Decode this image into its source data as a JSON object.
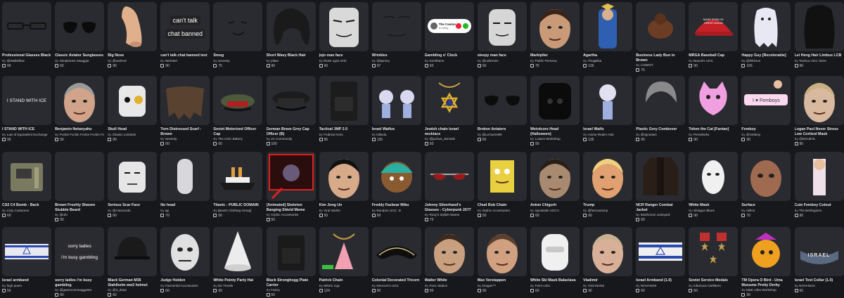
{
  "items": [
    {
      "name": "Professional Glasses Black",
      "creator": "@Wallstflow",
      "price": "90",
      "art": "glasses"
    },
    {
      "name": "Classic Aviator Sunglasses",
      "creator": "Simpletons Swagger",
      "price": "60",
      "art": "aviators"
    },
    {
      "name": "Big Nose",
      "creator": "@unDroX",
      "price": "90",
      "art": "nose"
    },
    {
      "name": "can't talk chat banned text",
      "creator": "Wembel",
      "price": "90",
      "art": "text",
      "text1": "can't talk",
      "text2": "chat banned"
    },
    {
      "name": "Smug",
      "creator": "Seventy",
      "price": "75",
      "art": "smug"
    },
    {
      "name": "Short Wavy Black Hair",
      "creator": "plitan",
      "price": "90",
      "art": "hair"
    },
    {
      "name": "jojo man face",
      "creator": "those ugcs smh",
      "price": "90",
      "art": "jojo"
    },
    {
      "name": "Wrinkles",
      "creator": "@5priory",
      "price": "97",
      "art": "wrinkles"
    },
    {
      "name": "Gambling o' Clock",
      "creator": "Kornflame",
      "price": "60",
      "art": "call",
      "text1": "The Casino",
      "text2": "is calling..."
    },
    {
      "name": "sleepy man face",
      "creator": "@uulkronin",
      "price": "50",
      "art": "sleepy"
    },
    {
      "name": "Markiplier",
      "creator": "Public Persona",
      "price": "75",
      "art": "face1"
    },
    {
      "name": "Agartha",
      "creator": "ThugBiba",
      "price": "135",
      "art": "agartha"
    },
    {
      "name": "Business Lady Bun in Brown",
      "creator": "LOWNIT",
      "price": "75",
      "art": "bun"
    },
    {
      "name": "MRGA Baseball Cap",
      "creator": "Bound's UGC",
      "price": "90",
      "art": "cap",
      "text1": "MAKE ROBLOX",
      "text2": "GREAT AGAIN"
    },
    {
      "name": "Happy Guy [Recolorable]",
      "creator": "@RKbrus",
      "price": "165",
      "art": "ghost"
    },
    {
      "name": "Lei Heng Hair Limbus LCB",
      "creator": "Touhou UGC Store",
      "price": "90",
      "art": "longhair"
    },
    {
      "name": "I STAND WITH ICE",
      "creator": "Law of Equivalent Exchange",
      "price": "90",
      "art": "text",
      "text1": "I STAND WITH ICE",
      "text2": ""
    },
    {
      "name": "Benjamin Netanyahu",
      "creator": "Fvckin Fvckin Fvckin Fvckin Fvckin",
      "price": "90",
      "art": "face2"
    },
    {
      "name": "Skull Head",
      "creator": "Classic Limiteds",
      "price": "90",
      "art": "skull"
    },
    {
      "name": "Torn Distressed Scarf - Brown",
      "creator": "Seventy",
      "price": "60",
      "art": "scarf"
    },
    {
      "name": "Soviet Motorized Officer Cap",
      "creator": "The UGC Bakery",
      "price": "60",
      "art": "officercap"
    },
    {
      "name": "German Brave Grey Cap Officer (B)",
      "creator": "JC Community",
      "price": "100",
      "art": "greycap"
    },
    {
      "name": "Tactical JMP 2.0",
      "creator": "Federal Arms",
      "price": "85",
      "art": "vest"
    },
    {
      "name": "Israel Waifus",
      "creator": "lollacla",
      "price": "135",
      "art": "waifus"
    },
    {
      "name": "Jewish chain Israel necklace",
      "creator": "@jachus_dominik",
      "price": "50",
      "art": "star"
    },
    {
      "name": "Broken Aviators",
      "creator": "@LeGame6R",
      "price": "60",
      "art": "brokenav"
    },
    {
      "name": "Weirdcore Head (Halloween)",
      "creator": "Luisa's Workshop",
      "price": "90",
      "art": "weird"
    },
    {
      "name": "Israel Waifu",
      "creator": "Anime Realm Hub",
      "price": "135",
      "art": "waifu"
    },
    {
      "name": "Plastic Grey Combover",
      "creator": "@vgcetass",
      "price": "90",
      "art": "combover"
    },
    {
      "name": "Token the Cat [Fantan]",
      "creator": "PeroWorks",
      "price": "90",
      "art": "cat"
    },
    {
      "name": "Femboy",
      "creator": "@rarfamy",
      "price": "90",
      "art": "femboy",
      "text1": "I ♥ Femboys",
      "text2": ""
    },
    {
      "name": "Logan Paul Never Stress Low Cortisol Mask",
      "creator": "@EGU87IL",
      "price": "90",
      "art": "face3"
    },
    {
      "name": "CS2 C4 Bomb - Back",
      "creator": "Coty Costumes",
      "price": "60",
      "art": "bomb"
    },
    {
      "name": "Brown Freshly Shaven Stubble Beard",
      "creator": "@ufo",
      "price": "90",
      "art": "stubble"
    },
    {
      "name": "Serious Scar Face",
      "creator": "@Antonrode",
      "price": "60",
      "art": "serious"
    },
    {
      "name": "No head",
      "creator": "ap",
      "price": "70",
      "art": "nohead"
    },
    {
      "name": "Titanic - PUBLIC DOMAIN",
      "creator": "[Boat's Clothing Group]",
      "price": "50",
      "art": "titanic"
    },
    {
      "name": "[Animated] Skeleton Banging Shield Meme",
      "creator": "Orphic Accessories",
      "price": "50",
      "art": "skeleton"
    },
    {
      "name": "Kim Jong Un",
      "creator": "Viral Works",
      "price": "50",
      "art": "face4"
    },
    {
      "name": "Freddy Fazbear Miku",
      "creator": "Random UGC :D",
      "price": "50",
      "art": "miku"
    },
    {
      "name": "Johnny Silverhand's Glasses - Cyberpunk 2077",
      "creator": "Roxy's Stylish Wares",
      "price": "70",
      "art": "johnny"
    },
    {
      "name": "Chud Bob Chain",
      "creator": "Orphic Accessories",
      "price": "50",
      "art": "chudbob"
    },
    {
      "name": "Anton Chigurh",
      "creator": "SpookIde UGC's",
      "price": "60",
      "art": "face5"
    },
    {
      "name": "Trump",
      "creator": "@famoussmp",
      "price": "90",
      "art": "face6"
    },
    {
      "name": "NCR Ranger Combat Jacket",
      "creator": "Mushroom Junkyard",
      "price": "60",
      "art": "jacket"
    },
    {
      "name": "White Mask",
      "creator": "Shotgun Blues",
      "price": "90",
      "art": "whitemask"
    },
    {
      "name": "Surface",
      "creator": "riello4",
      "price": "70",
      "art": "surface"
    },
    {
      "name": "Cute Femboy Cutout",
      "creator": "The Berlingtons",
      "price": "90",
      "art": "cutout"
    },
    {
      "name": "Israel armband",
      "creator": "high poem",
      "price": "50",
      "art": "armband"
    },
    {
      "name": "sorry ladies i'm busy gambling",
      "creator": "@gamecommaggarter",
      "price": "90",
      "art": "text2",
      "text1": "sorry ladies",
      "text2": "i'm busy gambling"
    },
    {
      "name": "Black German M35 Stahlhelm ww2 helmet",
      "creator": "@3_d3a4",
      "price": "60",
      "art": "helmet"
    },
    {
      "name": "Judge Holden",
      "creator": "Farmerkid Accessories",
      "price": "60",
      "art": "holden"
    },
    {
      "name": "White Pointy Party Hat",
      "creator": "Dir Trends",
      "price": "60",
      "art": "cone"
    },
    {
      "name": "Black Stronghogg Plate Carrier",
      "creator": "Fatcry",
      "price": "50",
      "art": "carrier"
    },
    {
      "name": "Patrick Chain",
      "creator": "MRSC Ugc",
      "price": "124",
      "art": "patrick"
    },
    {
      "name": "Colonial Decorated Tricorn",
      "creator": "DeeLion's UGC",
      "price": "90",
      "art": "tricorn"
    },
    {
      "name": "Walter White",
      "creator": "Face Station",
      "price": "90",
      "art": "face7"
    },
    {
      "name": "Max Verstappen",
      "creator": "Dragon™",
      "price": "90",
      "art": "face8"
    },
    {
      "name": "White Ski Mask Balaclava",
      "creator": "Point UGC",
      "price": "60",
      "art": "balaclava"
    },
    {
      "name": "Vladimir",
      "creator": "Viral Works",
      "price": "90",
      "art": "face9"
    },
    {
      "name": "Israel Armband (1.0)",
      "creator": "NOVANOS",
      "price": "60",
      "art": "armband2"
    },
    {
      "name": "Soviet Service Medals",
      "creator": "Infamous Outfitters",
      "price": "60",
      "art": "medals"
    },
    {
      "name": "TM Opera O Bird - Uma Musume Pretty Derby",
      "creator": "M&K Ultra Workshop",
      "price": "90",
      "art": "bird"
    },
    {
      "name": "Israel Text Collar (1.0)",
      "creator": "NOVANOS",
      "price": "60",
      "art": "collar",
      "text1": "ISRAEL",
      "text2": ""
    }
  ],
  "labels": {
    "by": "By"
  },
  "colors": {
    "bg": "#17181b",
    "card": "#2a2b30",
    "accent": "#1e90ff",
    "red": "#c0282c"
  }
}
